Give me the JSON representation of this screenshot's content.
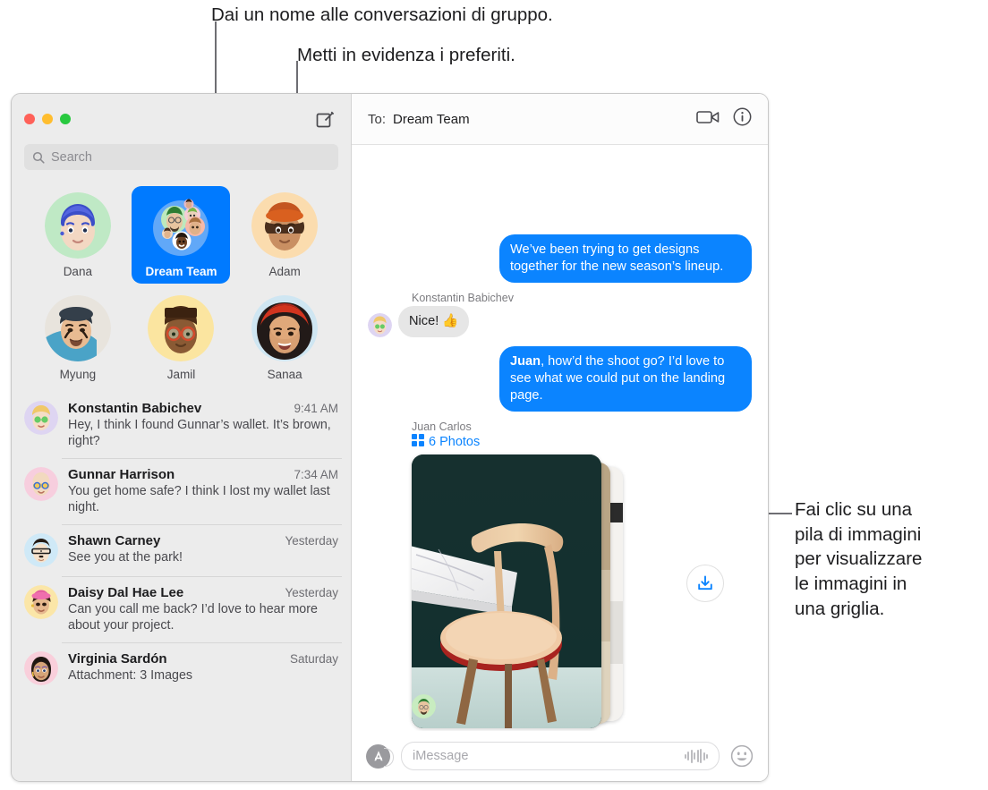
{
  "callouts": {
    "top_left": "Dai un nome alle conversazioni di gruppo.",
    "top_right": "Metti in evidenza i preferiti.",
    "right": "Fai clic su una\npila di immagini\nper visualizzare\nle immagini in\nuna griglia."
  },
  "window": {
    "traffic_lights": [
      "close",
      "minimize",
      "zoom"
    ],
    "compose_icon": "compose-icon"
  },
  "sidebar": {
    "search": {
      "placeholder": "Search",
      "icon": "search-icon"
    },
    "pinned": [
      {
        "name": "Dana",
        "selected": false,
        "avatar": "memoji-dana"
      },
      {
        "name": "Dream Team",
        "selected": true,
        "avatar": "group-memoji-stack"
      },
      {
        "name": "Adam",
        "selected": false,
        "avatar": "memoji-adam"
      },
      {
        "name": "Myung",
        "selected": false,
        "avatar": "photo-myung"
      },
      {
        "name": "Jamil",
        "selected": false,
        "avatar": "memoji-jamil"
      },
      {
        "name": "Sanaa",
        "selected": false,
        "avatar": "photo-sanaa"
      }
    ],
    "conversations": [
      {
        "name": "Konstantin Babichev",
        "time": "9:41 AM",
        "preview": "Hey, I think I found Gunnar’s wallet. It’s brown, right?",
        "avatar": "memoji-konstantin"
      },
      {
        "name": "Gunnar Harrison",
        "time": "7:34 AM",
        "preview": "You get home safe? I think I lost my wallet last night.",
        "avatar": "memoji-gunnar"
      },
      {
        "name": "Shawn Carney",
        "time": "Yesterday",
        "preview": "See you at the park!",
        "avatar": "memoji-shawn"
      },
      {
        "name": "Daisy Dal Hae Lee",
        "time": "Yesterday",
        "preview": "Can you call me back? I’d love to hear more about your project.",
        "avatar": "memoji-daisy"
      },
      {
        "name": "Virginia Sardón",
        "time": "Saturday",
        "preview": "Attachment: 3 Images",
        "avatar": "memoji-virginia"
      }
    ]
  },
  "thread": {
    "to_label": "To:",
    "to_value": "Dream Team",
    "facetime_icon": "video-camera-icon",
    "info_icon": "info-circle-icon",
    "messages": [
      {
        "direction": "outgoing",
        "text": "We’ve been trying to get designs together for the new season’s lineup."
      },
      {
        "direction": "incoming",
        "sender": "Konstantin Babichev",
        "text": "Nice! 👍",
        "avatar": "memoji-konstantin"
      },
      {
        "direction": "outgoing",
        "mention": "Juan",
        "text": ", how’d the shoot go? I’d love to see what we could put on the landing page."
      }
    ],
    "attachment": {
      "sender": "Juan Carlos",
      "count_label": "6 Photos",
      "grid_icon": "photo-grid-icon",
      "save_icon": "save-download-icon",
      "avatar": "memoji-juan"
    }
  },
  "compose": {
    "apps_icon": "app-store-icon",
    "placeholder": "iMessage",
    "audio_icon": "audio-waveform-icon",
    "emoji_icon": "emoji-smiley-icon"
  },
  "colors": {
    "accent_blue": "#007aff",
    "bubble_blue": "#0b84ff",
    "bubble_gray": "#e6e6e6",
    "sidebar_bg": "#ececec",
    "traffic_red": "#ff6159",
    "traffic_yellow": "#ffbd2e",
    "traffic_green": "#28c93f"
  }
}
